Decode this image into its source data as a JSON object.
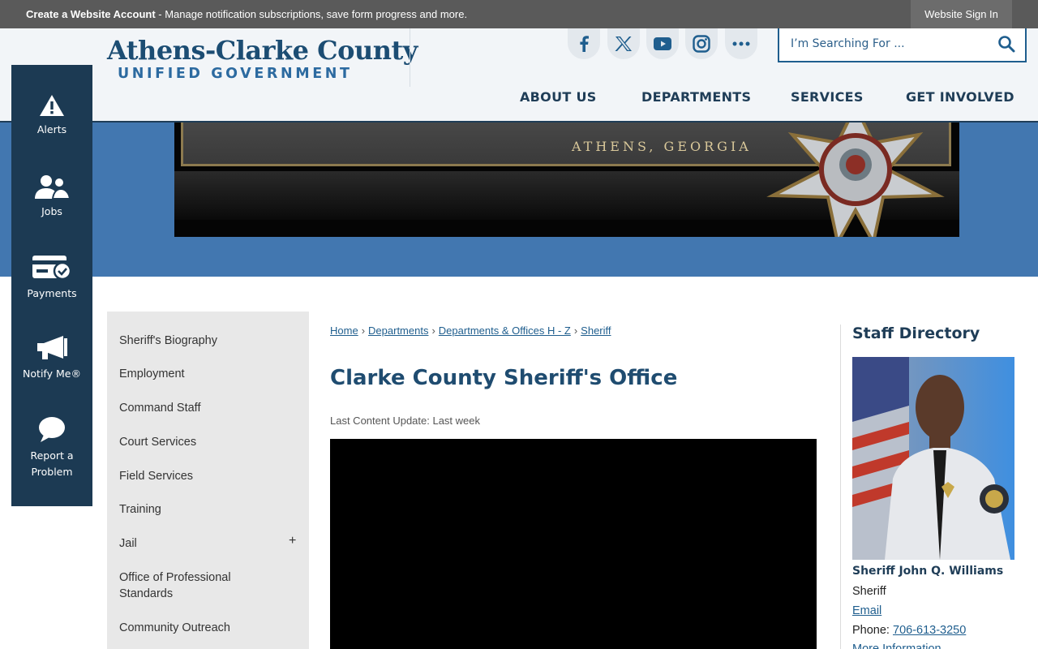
{
  "topbar": {
    "create_account": "Create a Website Account",
    "message": " - Manage notification subscriptions, save form progress and more.",
    "sign_in": "Website Sign In"
  },
  "logo": {
    "line1": "Athens-Clarke County",
    "line2": "UNIFIED GOVERNMENT"
  },
  "social": [
    "facebook-icon",
    "x-icon",
    "youtube-icon",
    "instagram-icon",
    "more-icon"
  ],
  "search": {
    "placeholder": "I’m Searching For ..."
  },
  "nav": [
    "ABOUT US",
    "DEPARTMENTS",
    "SERVICES",
    "GET INVOLVED"
  ],
  "banner": {
    "text": "ATHENS, GEORGIA"
  },
  "quick_links": [
    "Alerts",
    "Jobs",
    "Payments",
    "Notify Me®",
    "Report a Problem"
  ],
  "side_nav": [
    "Sheriff's Biography",
    "Employment",
    "Command Staff",
    "Court Services",
    "Field Services",
    "Training",
    "Jail",
    "Office of Professional Standards",
    "Community Outreach"
  ],
  "side_nav_expand": "+",
  "breadcrumb": [
    "Home",
    "Departments",
    "Departments & Offices H - Z",
    "Sheriff"
  ],
  "breadcrumb_sep": "›",
  "page_title": "Clarke County Sheriff's Office",
  "last_update": "Last Content Update: Last week",
  "staff": {
    "heading": "Staff Directory",
    "name": "Sheriff John Q. Williams",
    "title": "Sheriff",
    "email": "Email",
    "phone_label": "Phone: ",
    "phone": "706-613-3250",
    "more": "More Information"
  },
  "colors": {
    "navy": "#1c3a53",
    "banner_blue": "#4277b0",
    "link": "#1f5e8e",
    "topbar": "#5a5a5a"
  }
}
